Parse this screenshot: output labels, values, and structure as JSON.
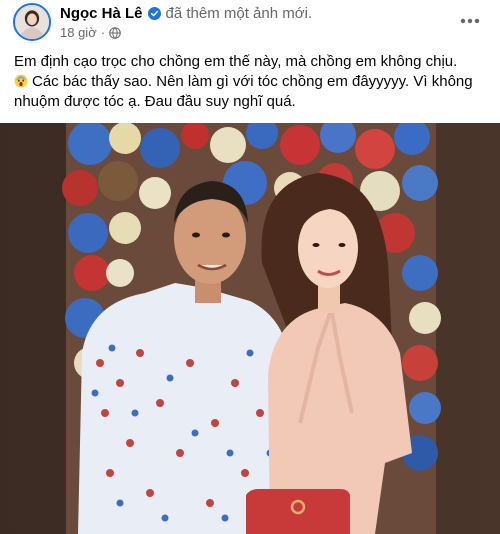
{
  "post": {
    "author": "Ngọc Hà Lê",
    "action": "đã thêm một ảnh mới.",
    "time": "18 giờ",
    "separator": "·",
    "text_line1": "Em định cạo trọc cho chồng em thế này, mà chồng em không chịu.",
    "text_line2": "Các bác thấy sao. Nên làm gì với tóc chồng em đâyyyyy. Vì không",
    "text_line3": "nhuộm được tóc ạ. Đau đầu suy nghĩ quá."
  },
  "icons": {
    "verified": "verified-badge-icon",
    "privacy": "globe-icon",
    "more": "more-options-icon",
    "emoji": "screaming-face-emoji"
  },
  "colors": {
    "facebook_blue": "#1b74e4",
    "secondary_text": "#65676b",
    "primary_text": "#050505"
  }
}
